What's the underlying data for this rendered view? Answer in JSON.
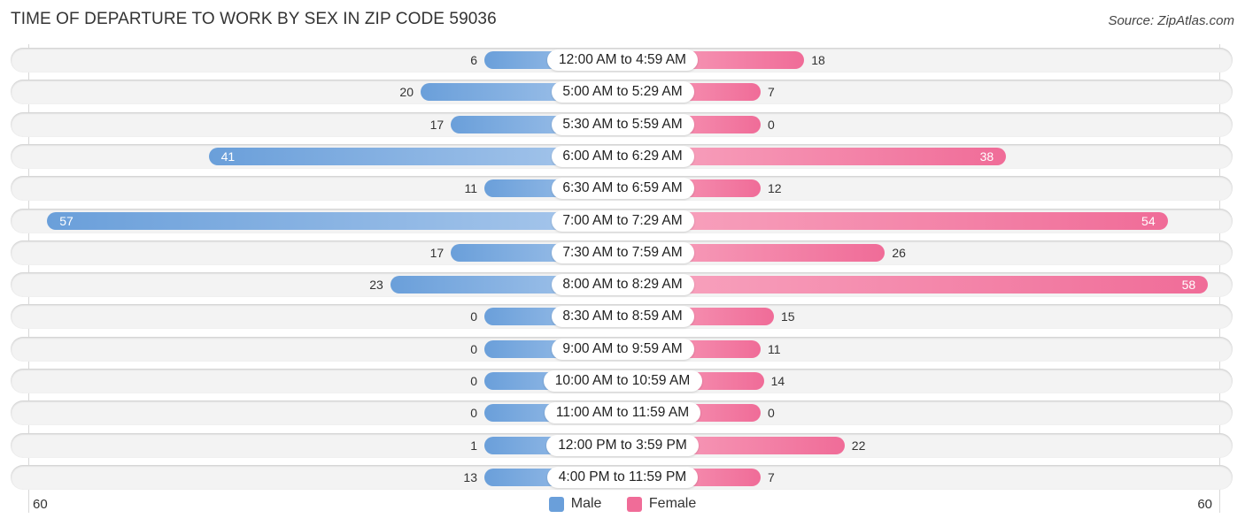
{
  "chart_data": {
    "type": "bar",
    "orientation": "horizontal-diverging",
    "title": "TIME OF DEPARTURE TO WORK BY SEX IN ZIP CODE 59036",
    "source": "Source: ZipAtlas.com",
    "categories": [
      "12:00 AM to 4:59 AM",
      "5:00 AM to 5:29 AM",
      "5:30 AM to 5:59 AM",
      "6:00 AM to 6:29 AM",
      "6:30 AM to 6:59 AM",
      "7:00 AM to 7:29 AM",
      "7:30 AM to 7:59 AM",
      "8:00 AM to 8:29 AM",
      "8:30 AM to 8:59 AM",
      "9:00 AM to 9:59 AM",
      "10:00 AM to 10:59 AM",
      "11:00 AM to 11:59 AM",
      "12:00 PM to 3:59 PM",
      "4:00 PM to 11:59 PM"
    ],
    "series": [
      {
        "name": "Male",
        "color": "#6a9fda",
        "values": [
          6,
          20,
          17,
          41,
          11,
          57,
          17,
          23,
          0,
          0,
          0,
          0,
          1,
          13
        ]
      },
      {
        "name": "Female",
        "color": "#f06c98",
        "values": [
          18,
          7,
          0,
          38,
          12,
          54,
          26,
          58,
          15,
          11,
          14,
          0,
          22,
          7
        ]
      }
    ],
    "axis": {
      "left_label": "60",
      "right_label": "60",
      "range": [
        0,
        60
      ]
    },
    "legend": {
      "position": "bottom-center",
      "items": [
        "Male",
        "Female"
      ]
    },
    "grid": false
  }
}
